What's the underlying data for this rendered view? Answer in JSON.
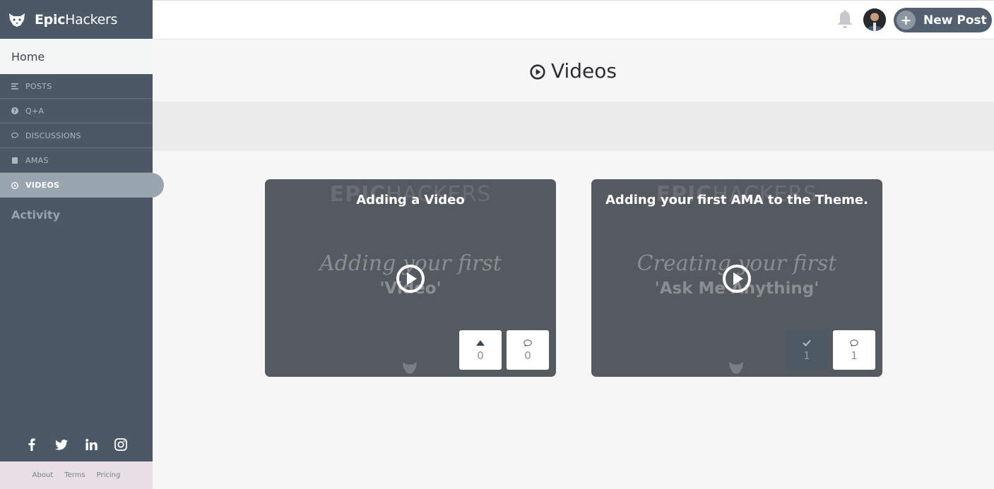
{
  "brand": {
    "name_bold": "Epic",
    "name_regular": "Hackers"
  },
  "sidebar": {
    "home_label": "Home",
    "items": [
      {
        "label": "POSTS",
        "icon": "list-icon"
      },
      {
        "label": "Q+A",
        "icon": "question-icon"
      },
      {
        "label": "DISCUSSIONS",
        "icon": "chat-bubble-icon"
      },
      {
        "label": "AMAS",
        "icon": "square-icon"
      },
      {
        "label": "VIDEOS",
        "icon": "play-icon",
        "active": true
      }
    ],
    "activity_label": "Activity",
    "socials": [
      "facebook-icon",
      "twitter-icon",
      "linkedin-icon",
      "instagram-icon"
    ],
    "footer_links": [
      "About",
      "Terms",
      "Pricing"
    ]
  },
  "header": {
    "new_post_label": "New Post"
  },
  "page": {
    "title": "Videos"
  },
  "videos": [
    {
      "title": "Adding a Video",
      "watermark_bold": "EPIC",
      "watermark_regular": "HACKERS",
      "thumb_line1": "Adding your first",
      "thumb_line2": "'Video'",
      "stat1_count": "0",
      "comments": "0"
    },
    {
      "title": "Adding your first AMA to the Theme.",
      "watermark_bold": "EPIC",
      "watermark_regular": "HACKERS",
      "thumb_line1": "Creating your first",
      "thumb_line2": "'Ask Me Anything'",
      "stat1_count": "1",
      "comments": "1"
    }
  ],
  "colors": {
    "sidebar": "#4b5866",
    "accent": "#526070",
    "active_nav": "#9aa6af",
    "card": "#555960"
  }
}
